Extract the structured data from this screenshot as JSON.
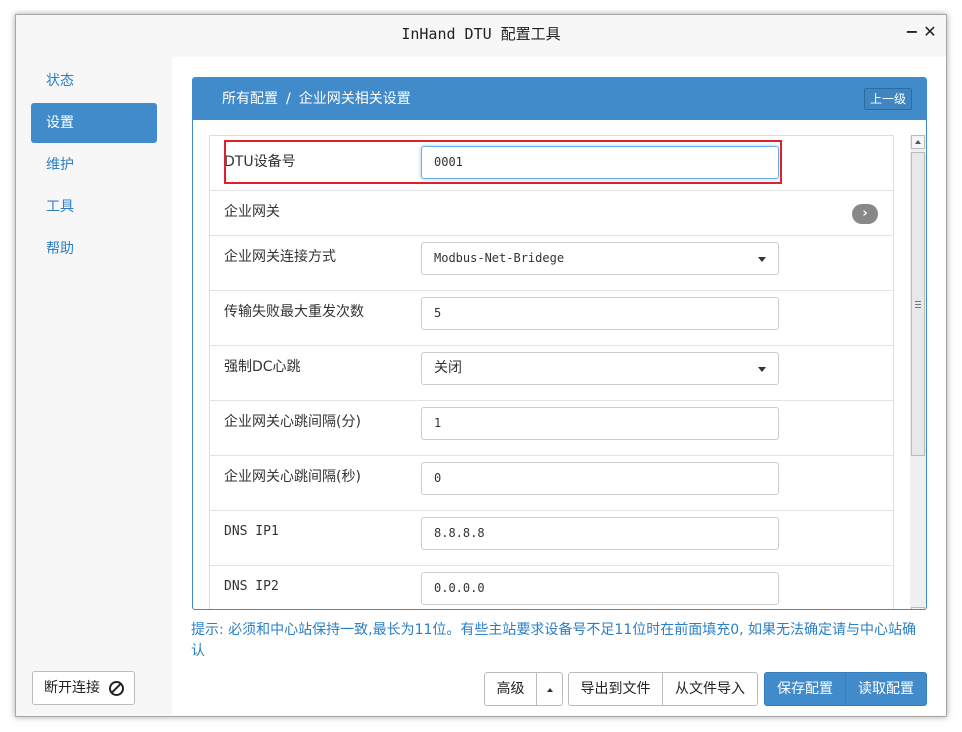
{
  "window": {
    "title": "InHand DTU 配置工具",
    "minimize": "−",
    "close": "✕"
  },
  "sidebar": {
    "items": [
      {
        "label": "状态",
        "active": false
      },
      {
        "label": "设置",
        "active": true
      },
      {
        "label": "维护",
        "active": false
      },
      {
        "label": "工具",
        "active": false
      },
      {
        "label": "帮助",
        "active": false
      }
    ],
    "disconnect_label": "断开连接"
  },
  "breadcrumb": {
    "root": "所有配置",
    "separator": "/",
    "current": "企业网关相关设置",
    "up_button": "上一级"
  },
  "form": {
    "dtu_id": {
      "label": "DTU设备号",
      "value": "0001"
    },
    "gateway": {
      "label": "企业网关",
      "icon": "chevron-right-icon"
    },
    "connect_mode": {
      "label": "企业网关连接方式",
      "value": "Modbus-Net-Bridege"
    },
    "max_retries": {
      "label": "传输失败最大重发次数",
      "value": "5"
    },
    "force_dc_heartbeat": {
      "label": "强制DC心跳",
      "value": "关闭"
    },
    "heartbeat_min": {
      "label": "企业网关心跳间隔(分)",
      "value": "1"
    },
    "heartbeat_sec": {
      "label": "企业网关心跳间隔(秒)",
      "value": "0"
    },
    "dns1": {
      "label": "DNS IP1",
      "value": "8.8.8.8"
    },
    "dns2": {
      "label": "DNS IP2",
      "value": "0.0.0.0"
    }
  },
  "hint": "提示: 必须和中心站保持一致,最长为11位。有些主站要求设备号不足11位时在前面填充0, 如果无法确定请与中心站确认",
  "footer": {
    "advanced": "高级",
    "export": "导出到文件",
    "import": "从文件导入",
    "save": "保存配置",
    "read": "读取配置"
  },
  "colors": {
    "primary": "#428bca",
    "highlight": "#e0212b",
    "link": "#2a7fc8"
  }
}
